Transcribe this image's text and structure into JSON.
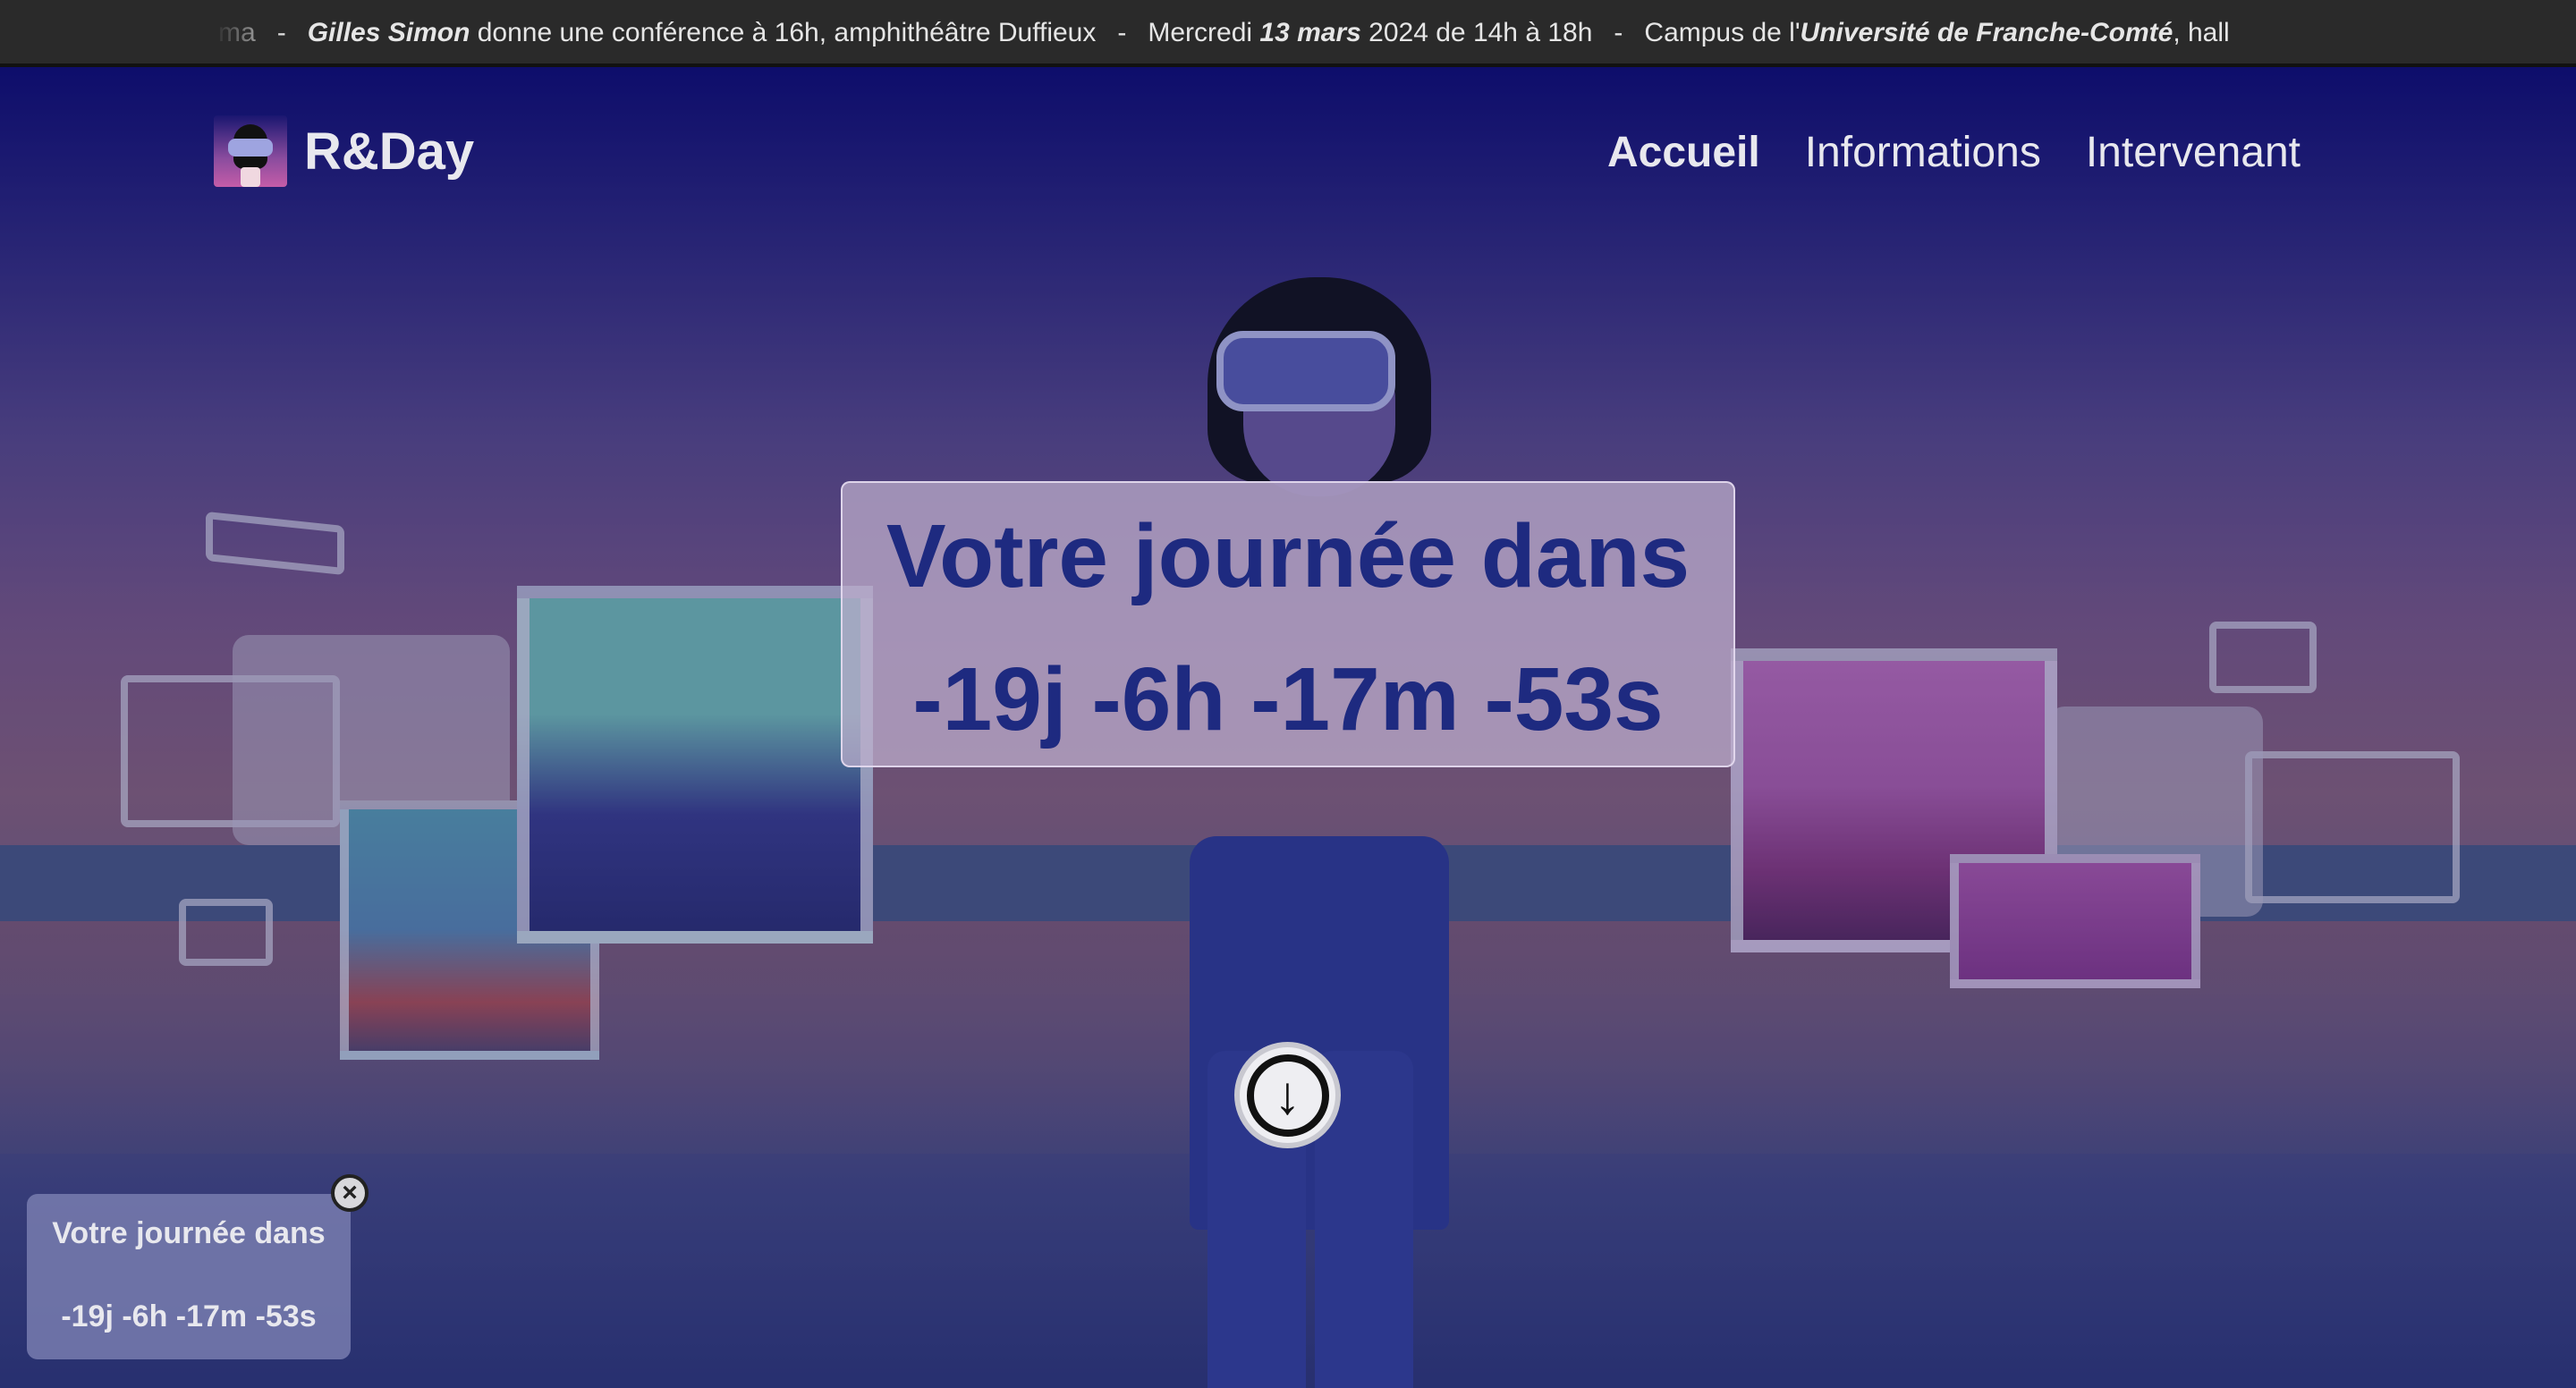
{
  "ticker": {
    "items": [
      {
        "lead": "ma",
        "bold": "",
        "rest": ""
      },
      {
        "lead": "",
        "bold": "Gilles Simon",
        "rest": " donne une conférence à 16h, amphithéâtre Duffieux"
      },
      {
        "lead": "Mercredi ",
        "bold": "13 mars",
        "rest": " 2024 de 14h à 18h"
      },
      {
        "lead": "Campus de l'",
        "bold": "Université de Franche-Comté",
        "rest": ", hall"
      }
    ],
    "separator": "-"
  },
  "nav": {
    "brand": "R&Day",
    "links": [
      "Accueil",
      "Informations",
      "Intervenant"
    ],
    "active": "Accueil"
  },
  "countdown": {
    "title": "Votre journée dans",
    "value": "-19j -6h -17m -53s"
  },
  "mini_widget": {
    "title": "Votre journée dans",
    "value": "-19j -6h -17m -53s",
    "close_icon": "close-icon"
  },
  "scroll_button": {
    "icon": "arrow-down-circle-icon"
  },
  "colors": {
    "title_blue": "#1e2a80",
    "ticker_bg": "#2a2a2a",
    "hero_top": "#0c0a6e"
  }
}
